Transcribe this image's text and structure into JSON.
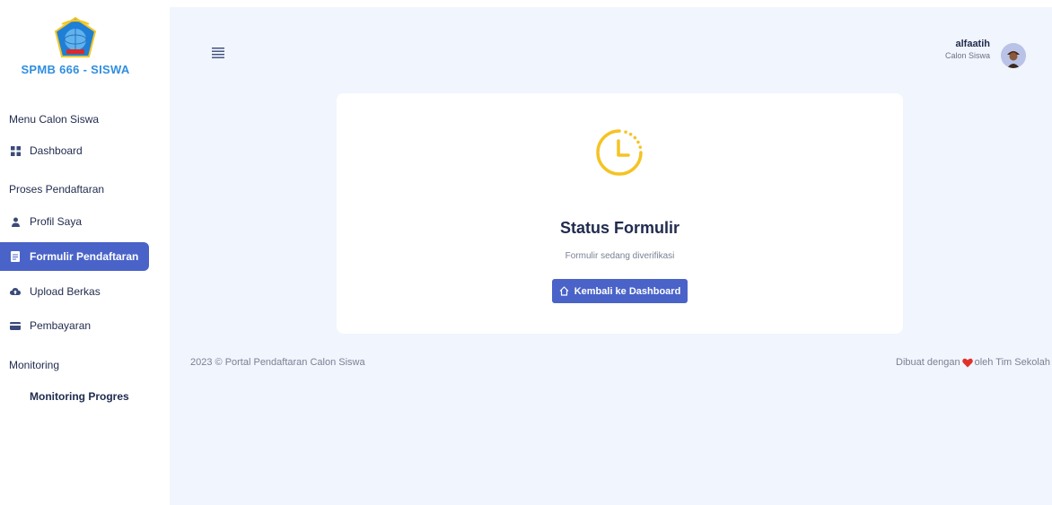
{
  "sidebar": {
    "brand": "SPMB 666 - SISWA",
    "sections": {
      "menu": "Menu Calon Siswa",
      "proses": "Proses Pendaftaran",
      "monitoring": "Monitoring"
    },
    "items": {
      "dashboard": "Dashboard",
      "profil": "Profil Saya",
      "formulir": "Formulir Pendaftaran",
      "upload": "Upload Berkas",
      "pembayaran": "Pembayaran",
      "monitoring_progres": "Monitoring Progres"
    },
    "active_item": "formulir"
  },
  "header": {
    "user_name": "alfaatih",
    "user_role": "Calon Siswa"
  },
  "card": {
    "title": "Status Formulir",
    "subtitle": "Formulir sedang diverifikasi",
    "button_label": "Kembali ke Dashboard"
  },
  "footer": {
    "left": "2023 © Portal Pendaftaran Calon Siswa",
    "right_before": "Dibuat dengan",
    "right_after": "oleh Tim Sekolah"
  },
  "colors": {
    "primary": "#4a63c8",
    "brand": "#2f8ee0",
    "status_icon": "#f5c324",
    "heart": "#e0322b",
    "background": "#f1f5fd"
  },
  "icons": {
    "dashboard": "grid-icon",
    "profil": "user-icon",
    "formulir": "document-icon",
    "upload": "cloud-upload-icon",
    "pembayaran": "credit-card-icon",
    "status": "clock-icon",
    "button": "home-icon"
  }
}
